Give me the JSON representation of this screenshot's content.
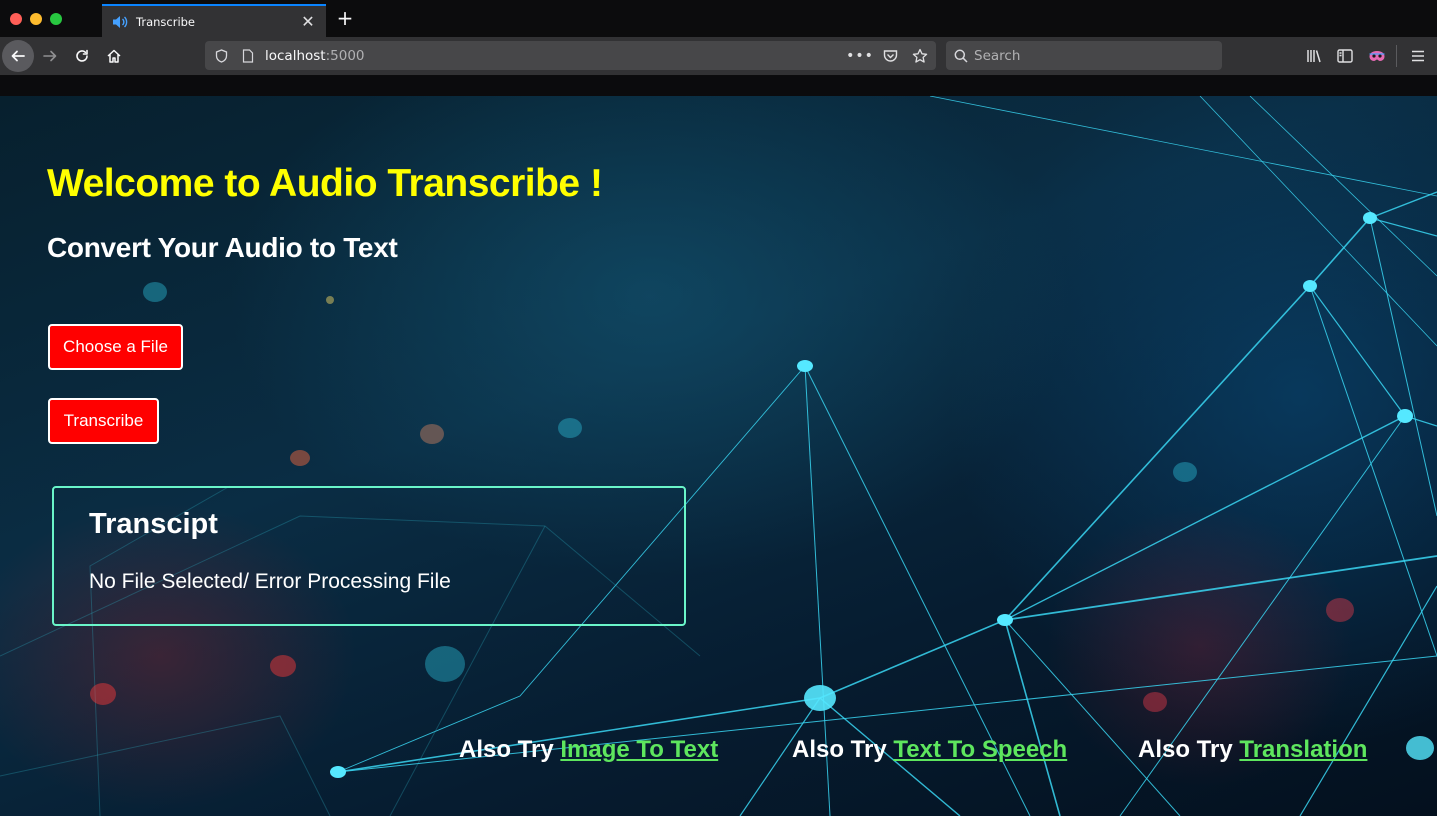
{
  "browser": {
    "tab_title": "Transcribe",
    "url_host": "localhost",
    "url_port": ":5000",
    "search_placeholder": "Search",
    "accent_color": "#0a84ff"
  },
  "page": {
    "heading": "Welcome to Audio Transcribe !",
    "subheading": "Convert Your Audio to Text",
    "choose_file_label": "Choose a File",
    "transcribe_label": "Transcribe",
    "transcript": {
      "title": "Transcipt",
      "text": "No File Selected/ Error Processing File"
    },
    "also_try": [
      {
        "prefix": "Also Try ",
        "link": "Image To Text"
      },
      {
        "prefix": "Also Try ",
        "link": "Text To Speech"
      },
      {
        "prefix": "Also Try ",
        "link": "Translation"
      }
    ],
    "colors": {
      "heading": "#ffff00",
      "button": "#ff0000",
      "box_border": "#6af5c9",
      "link": "#5ee65e"
    }
  }
}
